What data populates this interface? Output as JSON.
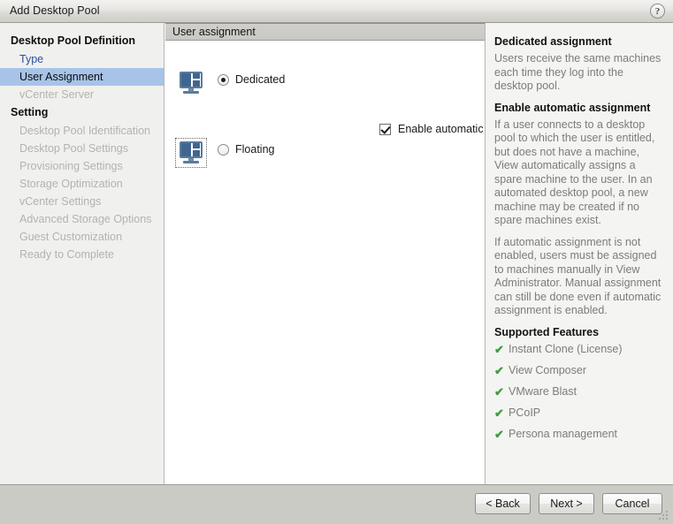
{
  "window": {
    "title": "Add Desktop Pool",
    "help_icon_label": "?"
  },
  "sidebar": {
    "groups": [
      {
        "label": "Desktop Pool Definition",
        "items": [
          {
            "label": "Type",
            "state": "link"
          },
          {
            "label": "User Assignment",
            "state": "selected"
          },
          {
            "label": "vCenter Server",
            "state": "disabled"
          }
        ]
      },
      {
        "label": "Setting",
        "items": [
          {
            "label": "Desktop Pool Identification",
            "state": "disabled"
          },
          {
            "label": "Desktop Pool Settings",
            "state": "disabled"
          },
          {
            "label": "Provisioning Settings",
            "state": "disabled"
          },
          {
            "label": "Storage Optimization",
            "state": "disabled"
          },
          {
            "label": "vCenter Settings",
            "state": "disabled"
          },
          {
            "label": "Advanced Storage Options",
            "state": "disabled"
          },
          {
            "label": "Guest Customization",
            "state": "disabled"
          },
          {
            "label": "Ready to Complete",
            "state": "disabled"
          }
        ]
      }
    ]
  },
  "main": {
    "section_title": "User assignment",
    "options": {
      "dedicated_label": "Dedicated",
      "dedicated_selected": true,
      "enable_auto_label": "Enable automatic assignment",
      "enable_auto_checked": true,
      "floating_label": "Floating",
      "floating_selected": false
    }
  },
  "help": {
    "heading_dedicated": "Dedicated assignment",
    "para_dedicated": "Users receive the same machines each time they log into the desktop pool.",
    "heading_enable_auto": "Enable automatic assignment",
    "para_auto_1": "If a user connects to a desktop pool to which the user is entitled, but does not have a machine, View automatically assigns a spare machine to the user. In an automated desktop pool, a new machine may be created if no spare machines exist.",
    "para_auto_2": "If automatic assignment is not enabled, users must be assigned to machines manually in View Administrator. Manual assignment can still be done even if automatic assignment is enabled.",
    "heading_features": "Supported Features",
    "check_glyph": "✔",
    "features": [
      "Instant Clone (License)",
      "View Composer",
      "VMware Blast",
      "PCoIP",
      "Persona management"
    ]
  },
  "footer": {
    "back_label": "< Back",
    "next_label": "Next >",
    "cancel_label": "Cancel"
  },
  "colors": {
    "selection_blue": "#a7c4e8",
    "link_blue": "#2f4f9f",
    "disabled_gray": "#b3b3ae",
    "help_text_gray": "#7c7c78",
    "check_green": "#3f9e3f",
    "monitor_blue": "#3f6690",
    "titlebar_gray": "#e6e5e2",
    "footer_gray": "#cbcbc6"
  }
}
